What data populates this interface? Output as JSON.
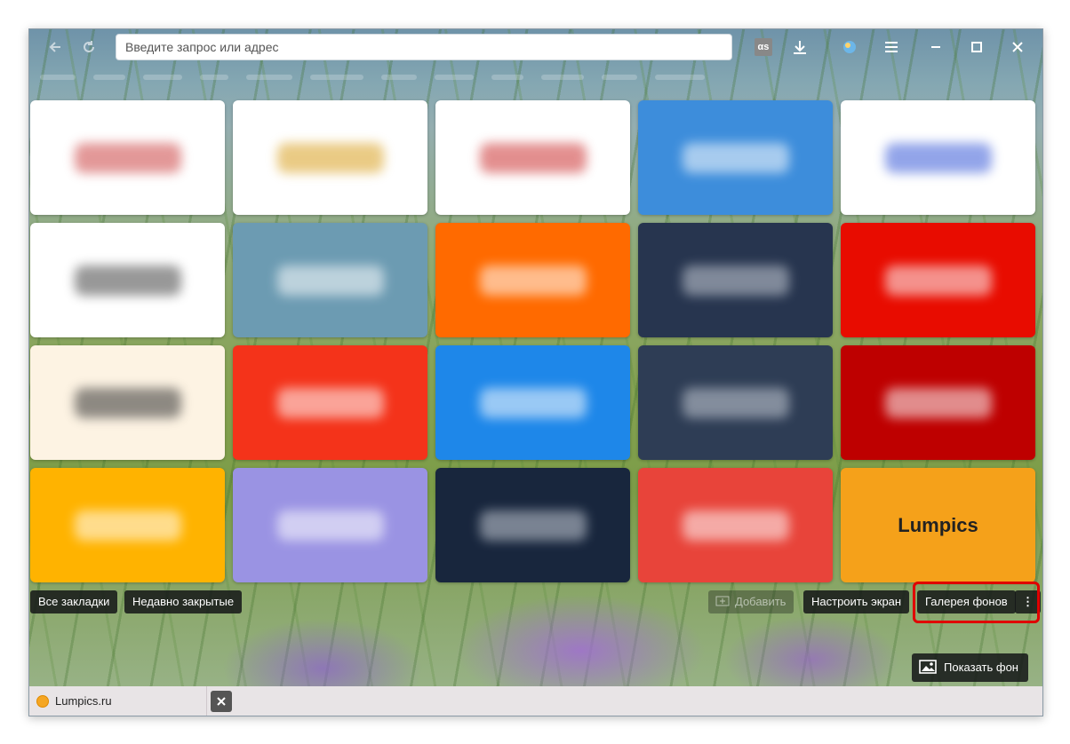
{
  "toolbar": {
    "back_icon": "back-arrow-icon",
    "reload_icon": "reload-icon",
    "address_placeholder": "Введите запрос или адрес",
    "icons": [
      "lastfm-icon",
      "download-icon",
      "weather-icon",
      "menu-icon",
      "minimize-icon",
      "maximize-icon",
      "close-icon"
    ]
  },
  "tiles": [
    {
      "bg": "#ffffff",
      "label": "",
      "label_color": "#c44"
    },
    {
      "bg": "#ffffff",
      "label": "",
      "label_color": "#d9a020"
    },
    {
      "bg": "#ffffff",
      "label": "",
      "label_color": "#c33"
    },
    {
      "bg": "#3d8ddb",
      "label": "",
      "label_color": "#ffffff"
    },
    {
      "bg": "#ffffff",
      "label": "",
      "label_color": "#3a5bd8"
    },
    {
      "bg": "#ffffff",
      "label": "",
      "label_color": "#444"
    },
    {
      "bg": "#6c9bb2",
      "label": "",
      "label_color": "#ffffff"
    },
    {
      "bg": "#ff6a00",
      "label": "",
      "label_color": "#ffffff"
    },
    {
      "bg": "#27354f",
      "label": "",
      "label_color": "#c9cfd8"
    },
    {
      "bg": "#e80c00",
      "label": "",
      "label_color": "#ffffff"
    },
    {
      "bg": "#fdf3e3",
      "label": "",
      "label_color": "#333"
    },
    {
      "bg": "#f4331a",
      "label": "",
      "label_color": "#ffffff"
    },
    {
      "bg": "#1e87e9",
      "label": "",
      "label_color": "#ffffff"
    },
    {
      "bg": "#2e3d55",
      "label": "",
      "label_color": "#c9cfd8"
    },
    {
      "bg": "#be0000",
      "label": "",
      "label_color": "#ffffff"
    },
    {
      "bg": "#ffb300",
      "label": "",
      "label_color": "#ffffff"
    },
    {
      "bg": "#9a93e3",
      "label": "",
      "label_color": "#ffffff"
    },
    {
      "bg": "#18263d",
      "label": "",
      "label_color": "#c9cfd8"
    },
    {
      "bg": "#e8443a",
      "label": "",
      "label_color": "#ffffff"
    },
    {
      "bg": "#f5a11a",
      "label": "Lumpics",
      "label_color": "#222"
    }
  ],
  "bottom_bar": {
    "all_bookmarks": "Все закладки",
    "recently_closed": "Недавно закрытые",
    "add": "Добавить",
    "customize": "Настроить экран",
    "gallery": "Галерея фонов",
    "more": "⋮",
    "show_background": "Показать фон"
  },
  "tabs": {
    "active_title": "Lumpics.ru"
  }
}
